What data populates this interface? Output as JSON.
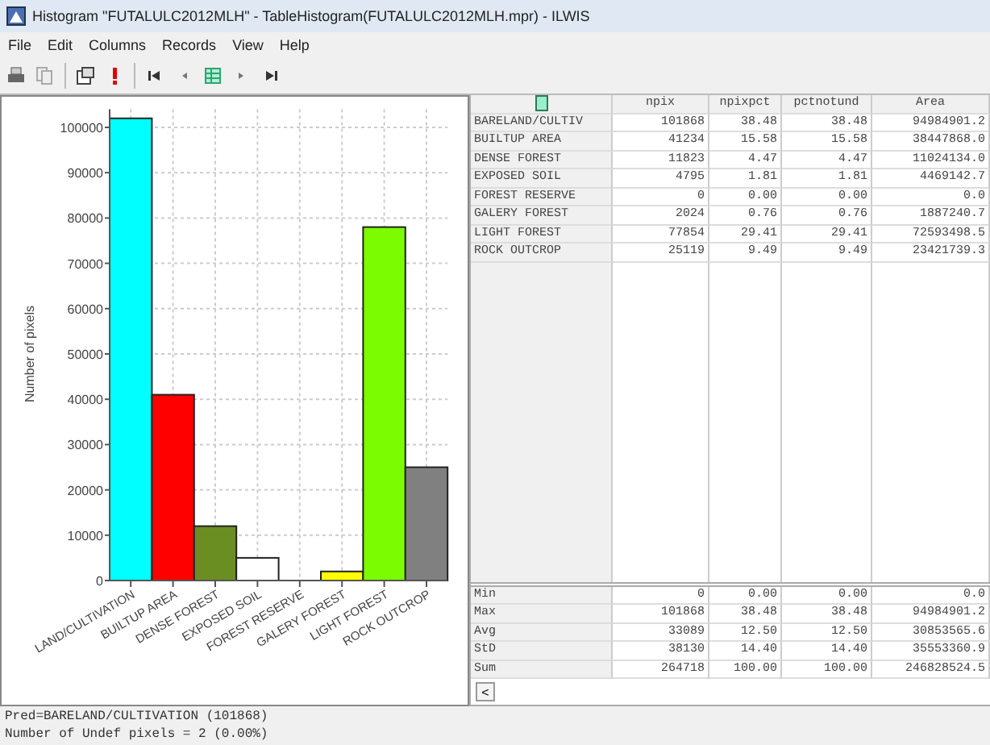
{
  "window": {
    "title": "Histogram \"FUTALULC2012MLH\" - TableHistogram(FUTALULC2012MLH.mpr) - ILWIS"
  },
  "menu": [
    "File",
    "Edit",
    "Columns",
    "Records",
    "View",
    "Help"
  ],
  "chart": {
    "chart_data": {
      "type": "bar",
      "ylabel": "Number of pixels",
      "categories": [
        "LAND/CULTIVATION",
        "BUILTUP AREA",
        "DENSE FOREST",
        "EXPOSED SOIL",
        "FOREST RESERVE",
        "GALERY FOREST",
        "LIGHT FOREST",
        "ROCK OUTCROP"
      ],
      "series": [
        {
          "values": [
            102000,
            41000,
            12000,
            5000,
            0,
            2000,
            78000,
            25000
          ]
        }
      ],
      "colors": [
        "#00ffff",
        "#ff0000",
        "#6b8e23",
        "#ffffff",
        "#ffffff",
        "#ffff00",
        "#7cfc00",
        "#808080"
      ],
      "grid": true,
      "ylim": [
        0,
        104000
      ],
      "yticks": [
        0,
        10000,
        20000,
        30000,
        40000,
        50000,
        60000,
        70000,
        80000,
        90000,
        100000
      ]
    }
  },
  "table": {
    "columns": [
      "npix",
      "npixpct",
      "pctnotund",
      "Area"
    ],
    "rows": [
      {
        "label": "BARELAND/CULTIV",
        "cells": [
          "101868",
          "38.48",
          "38.48",
          "94984901.2"
        ]
      },
      {
        "label": "BUILTUP AREA",
        "cells": [
          "41234",
          "15.58",
          "15.58",
          "38447868.0"
        ]
      },
      {
        "label": "DENSE FOREST",
        "cells": [
          "11823",
          "4.47",
          "4.47",
          "11024134.0"
        ]
      },
      {
        "label": "EXPOSED SOIL",
        "cells": [
          "4795",
          "1.81",
          "1.81",
          "4469142.7"
        ]
      },
      {
        "label": "FOREST RESERVE",
        "cells": [
          "0",
          "0.00",
          "0.00",
          "0.0"
        ]
      },
      {
        "label": "GALERY FOREST",
        "cells": [
          "2024",
          "0.76",
          "0.76",
          "1887240.7"
        ]
      },
      {
        "label": "LIGHT FOREST",
        "cells": [
          "77854",
          "29.41",
          "29.41",
          "72593498.5"
        ]
      },
      {
        "label": "ROCK OUTCROP",
        "cells": [
          "25119",
          "9.49",
          "9.49",
          "23421739.3"
        ]
      }
    ],
    "summary": [
      {
        "label": "Min",
        "cells": [
          "0",
          "0.00",
          "0.00",
          "0.0"
        ]
      },
      {
        "label": "Max",
        "cells": [
          "101868",
          "38.48",
          "38.48",
          "94984901.2"
        ]
      },
      {
        "label": "Avg",
        "cells": [
          "33089",
          "12.50",
          "12.50",
          "30853565.6"
        ]
      },
      {
        "label": "StD",
        "cells": [
          "38130",
          "14.40",
          "14.40",
          "35553360.9"
        ]
      },
      {
        "label": "Sum",
        "cells": [
          "264718",
          "100.00",
          "100.00",
          "246828524.5"
        ]
      }
    ],
    "scroll_button": "<"
  },
  "status_bar": [
    "Pred=BARELAND/CULTIVATION (101868)",
    "Number of Undef pixels = 2 (0.00%)"
  ]
}
